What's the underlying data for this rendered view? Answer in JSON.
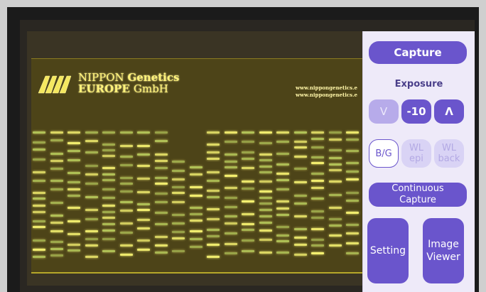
{
  "gel_image": {
    "company_line1_a": "NIPPON ",
    "company_line1_b": "Genetics",
    "company_line2_a": "EUROPE ",
    "company_line2_b": "GmbH",
    "url_line1": "www.nippongenetics.e",
    "url_line2": "www.nippongenetics.e",
    "band_color": "#f4f070",
    "band_color_green": "#cfe86a"
  },
  "panel": {
    "capture_label": "Capture",
    "exposure_label": "Exposure",
    "exposure_down_label": "V",
    "exposure_value": "-10",
    "exposure_up_label": "Λ",
    "mode_bg_label": "B/G",
    "mode_wl_epi_line1": "WL",
    "mode_wl_epi_line2": "epi",
    "mode_wl_back_line1": "WL",
    "mode_wl_back_line2": "back",
    "continuous_line1": "Continuous",
    "continuous_line2": "Capture",
    "setting_label": "Setting",
    "viewer_line1": "Image",
    "viewer_line2": "Viewer",
    "accent_color": "#6a55cc",
    "panel_bg": "#eeeaf9"
  }
}
